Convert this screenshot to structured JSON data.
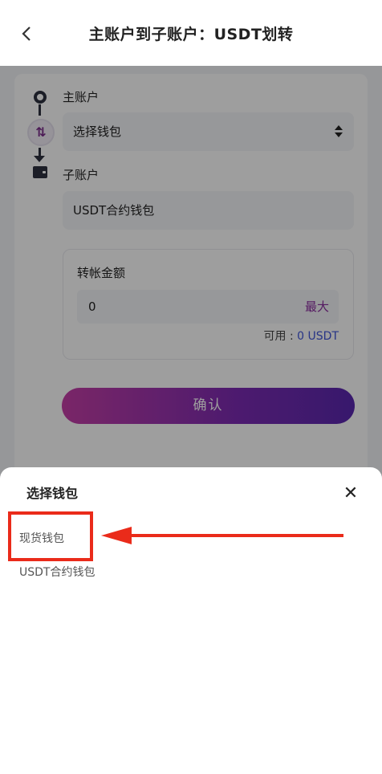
{
  "header": {
    "back_icon": "chevron-left-icon",
    "title": "主账户到子账户：USDT划转"
  },
  "transfer": {
    "from_label": "主账户",
    "from_select": "选择钱包",
    "to_label": "子账户",
    "to_value": "USDT合约钱包",
    "amount_label": "转帐金额",
    "amount_value": "0",
    "max_label": "最大",
    "available_prefix": "可用 : ",
    "available_value": "0 USDT",
    "confirm_label": "确认"
  },
  "sheet": {
    "title": "选择钱包",
    "options": [
      {
        "label": "现货钱包"
      },
      {
        "label": "USDT合约钱包"
      }
    ]
  },
  "colors": {
    "accent": "#7b2d8c",
    "highlight": "#ea2b1a",
    "link_blue": "#3f55d8"
  }
}
